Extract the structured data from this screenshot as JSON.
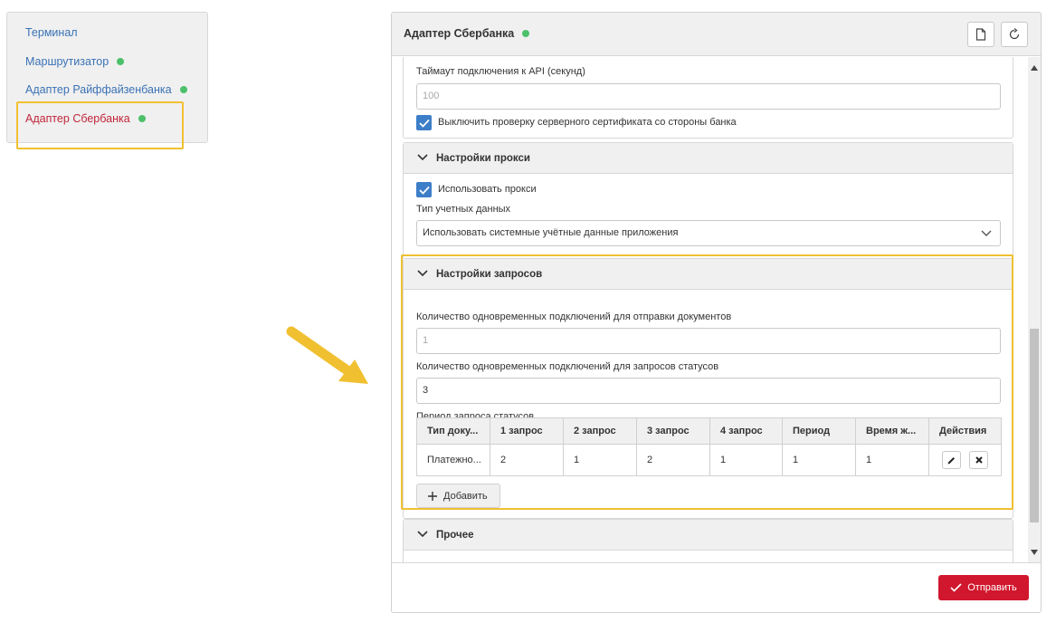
{
  "nav": {
    "items": [
      {
        "label": "Терминал",
        "status_dot": false
      },
      {
        "label": "Маршрутизатор",
        "status_dot": true
      },
      {
        "label": "Адаптер Райффайзенбанка",
        "status_dot": true
      },
      {
        "label": "Адаптер Сбербанка",
        "status_dot": true,
        "active": true
      }
    ]
  },
  "colors": {
    "link": "#3a72b5",
    "active": "#c0263a",
    "status_ok": "#4cc06a",
    "accent": "#d0172d",
    "checkbox": "#3d7ec8",
    "highlight": "#f0c030"
  },
  "panel": {
    "title": "Адаптер Сбербанка",
    "icons": [
      "file-icon",
      "refresh-icon"
    ]
  },
  "connection": {
    "timeout_label": "Таймаут подключения к API (секунд)",
    "timeout_placeholder": "100",
    "disable_cert_check_label": "Выключить проверку серверного сертификата со стороны банка",
    "disable_cert_check": true
  },
  "proxy": {
    "title": "Настройки прокси",
    "use_proxy_label": "Использовать прокси",
    "use_proxy": true,
    "cred_type_label": "Тип учетных данных",
    "cred_type_value": "Использовать системные учётные данные приложения"
  },
  "requests": {
    "title": "Настройки запросов",
    "docs_conn_label": "Количество одновременных подключений для отправки документов",
    "docs_conn_placeholder": "1",
    "status_conn_label": "Количество одновременных подключений для запросов статусов",
    "status_conn_value": "3",
    "period_label": "Период запроса статусов",
    "table": {
      "columns": [
        "Тип доку...",
        "1 запрос",
        "2 запрос",
        "3 запрос",
        "4 запрос",
        "Период",
        "Время ж...",
        "Действия"
      ],
      "rows": [
        [
          "Платежно...",
          "2",
          "1",
          "2",
          "1",
          "1",
          "1"
        ]
      ]
    },
    "add_label": "Добавить"
  },
  "other": {
    "title": "Прочее"
  },
  "footer": {
    "send_label": "Отправить"
  }
}
